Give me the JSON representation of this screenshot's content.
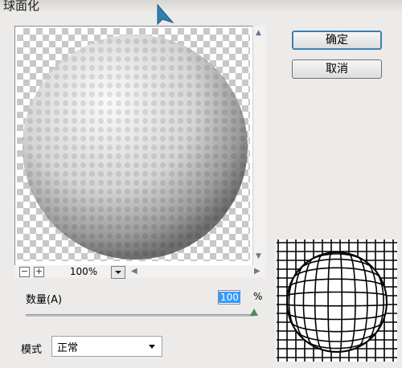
{
  "window": {
    "title": "球面化"
  },
  "preview": {
    "zoom_level": "100%",
    "zoom_out_label": "−",
    "zoom_in_label": "+"
  },
  "buttons": {
    "ok_label": "确定",
    "cancel_label": "取消"
  },
  "amount": {
    "label": "数量(A)",
    "value": "100",
    "unit": "%",
    "slider_fraction": 1.0
  },
  "mode": {
    "label": "模式",
    "selected": "正常"
  },
  "colors": {
    "accent": "#3399ff",
    "default_button_border": "#3c7fb1",
    "slider_thumb": "#4c8a5a"
  },
  "icons": [
    "cursor-arrow-icon",
    "zoom-out-icon",
    "zoom-in-icon",
    "dropdown-arrow-icon",
    "scroll-up-icon",
    "scroll-down-icon",
    "scroll-left-icon",
    "scroll-right-icon"
  ]
}
